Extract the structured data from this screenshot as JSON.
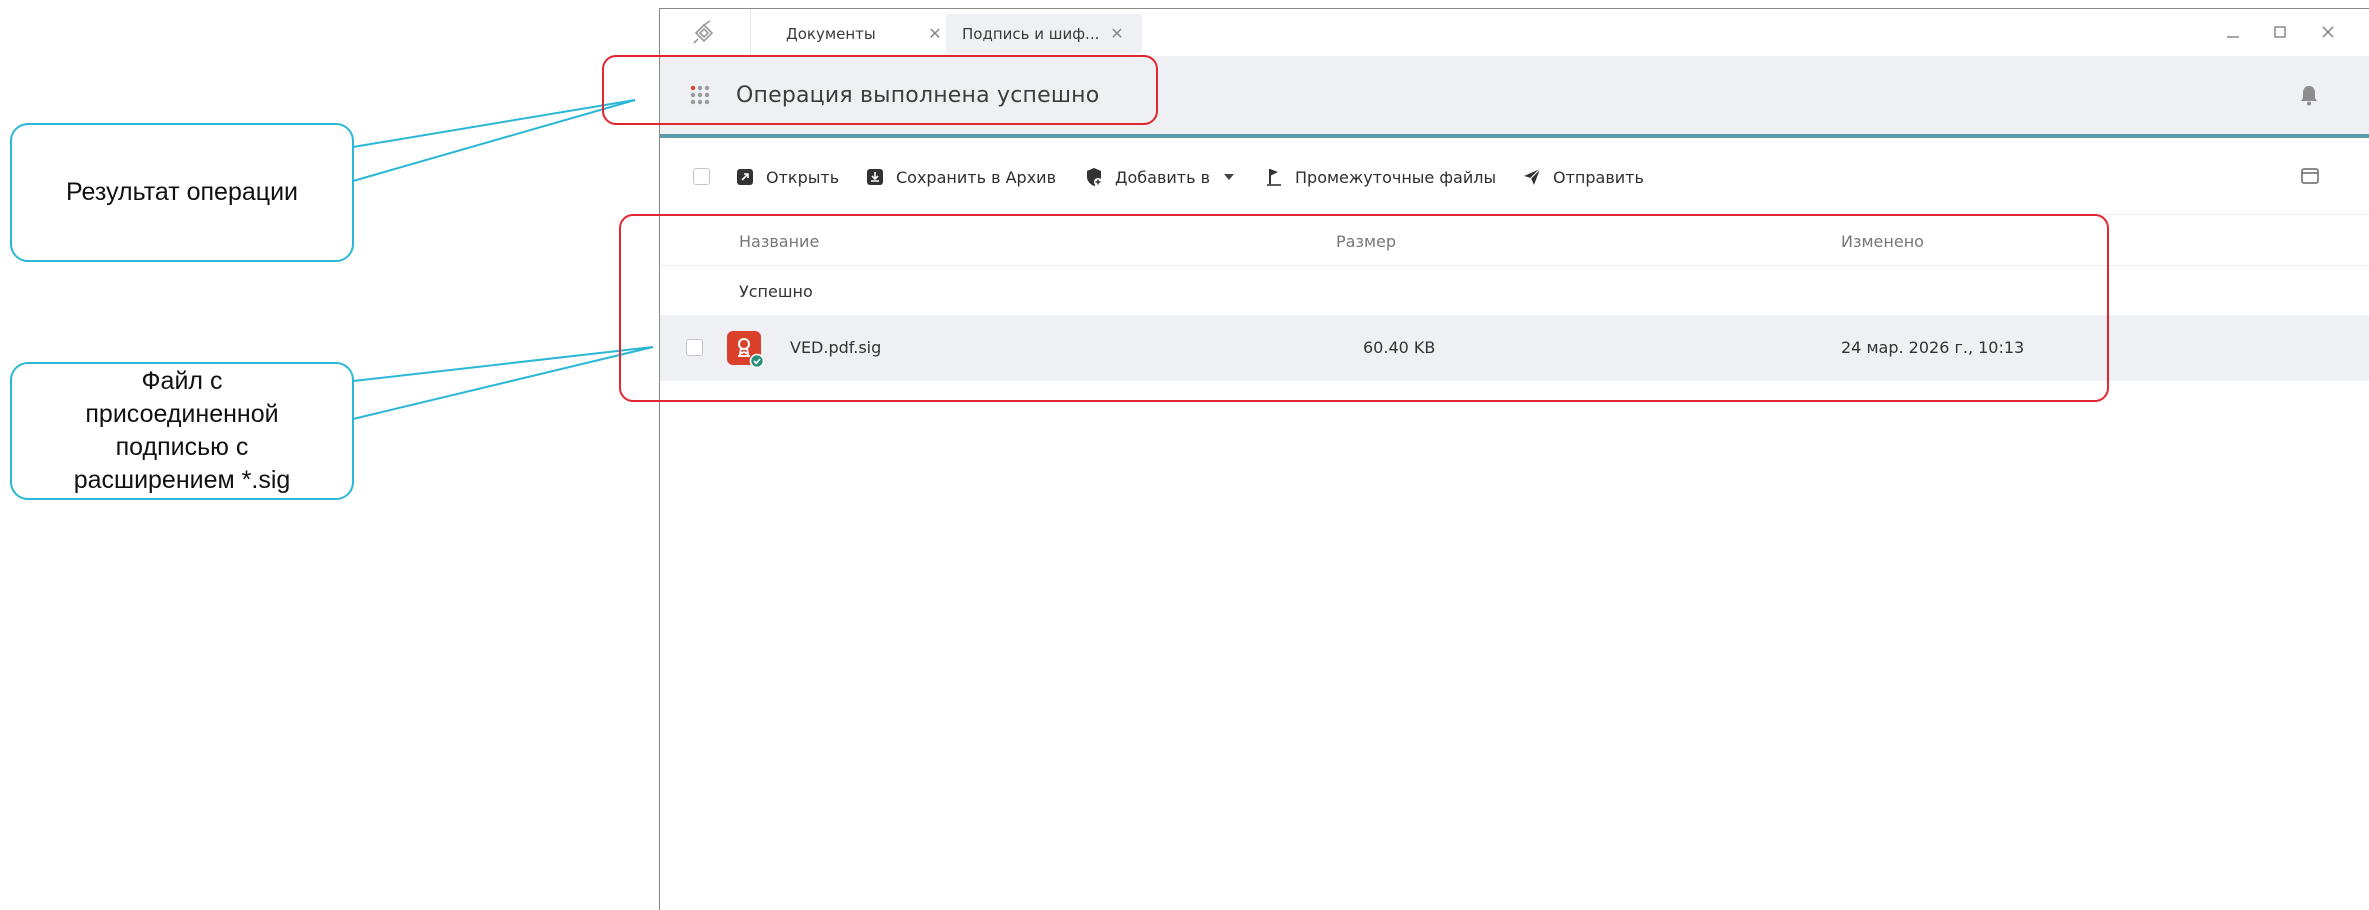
{
  "tabs": [
    {
      "label": "Документы"
    },
    {
      "label": "Подпись и шиф..."
    }
  ],
  "header": {
    "title": "Операция выполнена успешно"
  },
  "toolbar": {
    "open": "Открыть",
    "save_archive": "Сохранить в Архив",
    "add_to": "Добавить в",
    "intermediate": "Промежуточные файлы",
    "send": "Отправить"
  },
  "table": {
    "columns": {
      "name": "Название",
      "size": "Размер",
      "modified": "Изменено"
    },
    "group": "Успешно",
    "rows": [
      {
        "name": "VED.pdf.sig",
        "size": "60.40 KB",
        "modified": "24 мар. 2026 г., 10:13"
      }
    ]
  },
  "callouts": {
    "result": "Результат операции",
    "file": [
      "Файл с",
      "присоединенной",
      "подписью с",
      "расширением *.sig"
    ]
  },
  "colors": {
    "accent_line": "#5b9aa8",
    "annotation_frame": "#e0262e",
    "callout_border": "#2bb7d6",
    "file_icon": "#d9412b",
    "status_ok": "#2a8f7a"
  },
  "icons": {
    "app_logo": "app-logo-icon",
    "grid": "apps-grid-icon",
    "bell": "bell-icon",
    "open": "open-external-icon",
    "archive": "archive-icon",
    "add": "shield-add-icon",
    "intermediate": "flag-icon",
    "send": "send-icon",
    "panel": "panel-layout-icon",
    "file": "signed-file-icon"
  }
}
